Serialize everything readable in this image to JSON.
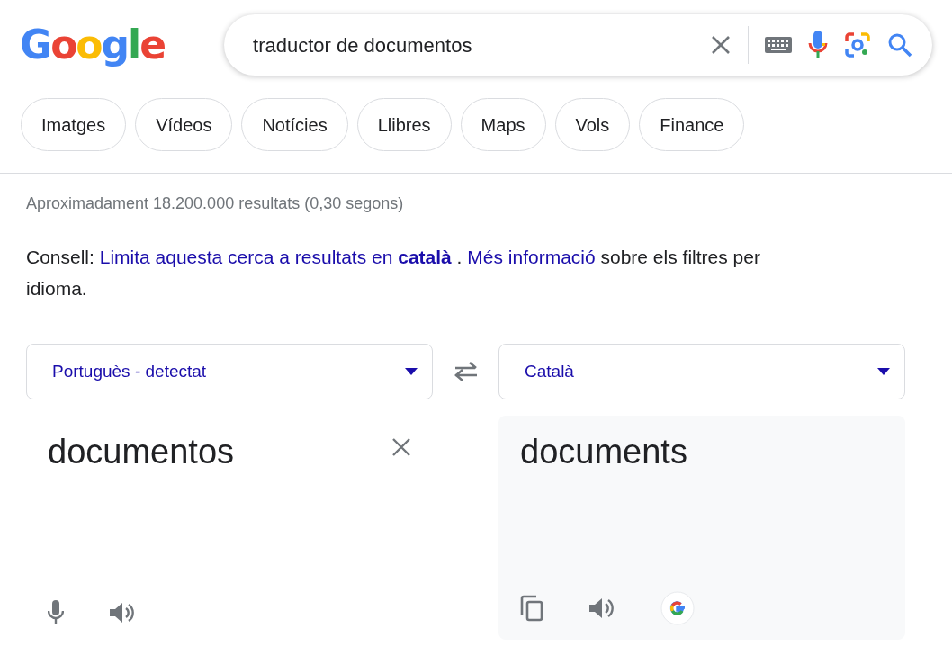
{
  "logo": "Google",
  "search": {
    "value": "traductor de documentos"
  },
  "chips": [
    {
      "label": "Imatges"
    },
    {
      "label": "Vídeos"
    },
    {
      "label": "Notícies"
    },
    {
      "label": "Llibres"
    },
    {
      "label": "Maps"
    },
    {
      "label": "Vols"
    },
    {
      "label": "Finance"
    }
  ],
  "result_stats": "Aproximadament 18.200.000 resultats (0,30 segons)",
  "tip": [
    {
      "kind": "text",
      "text": "Consell: "
    },
    {
      "kind": "link",
      "text": "Limita aquesta cerca a resultats en **català**"
    },
    {
      "kind": "text",
      "text": " . "
    },
    {
      "kind": "link",
      "text": "Més informació"
    },
    {
      "kind": "text",
      "text": " sobre els filtres per idioma."
    }
  ],
  "translator": {
    "source_language": "Portuguès - detectat",
    "target_language": "Català",
    "source_text": "documentos",
    "translated_text": "documents"
  }
}
